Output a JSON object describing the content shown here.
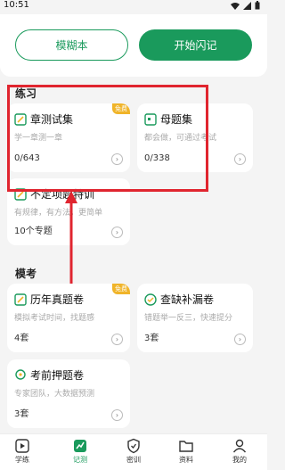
{
  "status": {
    "time": "10:51"
  },
  "top_buttons": {
    "blur": "模糊本",
    "flash": "开始闪记"
  },
  "sections": {
    "practice": "练习",
    "mock": "模考"
  },
  "cards": {
    "chapter": {
      "title": "章测试集",
      "subtitle": "学一章测一章",
      "count": "0/643",
      "badge": "免费"
    },
    "mother": {
      "title": "母题集",
      "subtitle": "都会做，可通过考试",
      "count": "0/338"
    },
    "random": {
      "title": "不定项题特训",
      "subtitle": "有规律，有方法，更简单",
      "count": "10个专题"
    },
    "past": {
      "title": "历年真题卷",
      "subtitle": "模拟考试时间，找题感",
      "count": "4套",
      "badge": "免费"
    },
    "gap": {
      "title": "查缺补漏卷",
      "subtitle": "错题举一反三，快速提分",
      "count": "3套"
    },
    "predict": {
      "title": "考前押题卷",
      "subtitle": "专家团队，大数据预测",
      "count": "3套"
    }
  },
  "nav": [
    {
      "label": "学练",
      "icon": "play-icon"
    },
    {
      "label": "记测",
      "icon": "chart-icon"
    },
    {
      "label": "密训",
      "icon": "shield-icon"
    },
    {
      "label": "资料",
      "icon": "folder-icon"
    },
    {
      "label": "我的",
      "icon": "user-icon"
    }
  ],
  "colors": {
    "accent": "#1a9a5c",
    "badge": "#f0b429",
    "highlight": "#e0252f"
  }
}
